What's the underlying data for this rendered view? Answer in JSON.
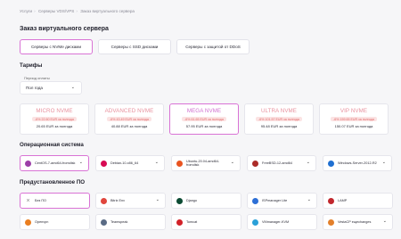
{
  "breadcrumb": [
    "Услуги",
    "Серверы VDS/VPS",
    "Заказ виртуального сервера"
  ],
  "page_title": "Заказ виртуального сервера",
  "server_tabs": [
    {
      "label": "Серверы с NVMe дисками",
      "active": true
    },
    {
      "label": "Серверы с SSD дисками",
      "active": false
    },
    {
      "label": "Серверы с защитой от DDoS",
      "active": false
    }
  ],
  "sections": {
    "tariffs": "Тарифы",
    "os": "Операционная система",
    "software": "Предустановленное ПО"
  },
  "period": {
    "label": "Период оплаты",
    "value": "Пол года",
    "icon": "chevron-down-icon"
  },
  "tariffs": [
    {
      "name": "MICRO NVME",
      "discount": "-6% 22.60 EUR за полгода",
      "price": "20.65 EUR за полгода",
      "active": false
    },
    {
      "name": "ADVANCED NVME",
      "discount": "-6% 43.49 EUR за полгода",
      "price": "40.88 EUR за полгода",
      "active": false
    },
    {
      "name": "MEGA NVME",
      "discount": "-6% 61.65 EUR за полгода",
      "price": "57.95 EUR за полгода",
      "active": true
    },
    {
      "name": "ULTRA NVME",
      "discount": "-6% 101.57 EUR за полгода",
      "price": "95.48 EUR за полгода",
      "active": false
    },
    {
      "name": "VIP NVME",
      "discount": "-6% 159.65 EUR за полгода",
      "price": "150.07 EUR за полгода",
      "active": false
    }
  ],
  "os": [
    {
      "label": "CentOS-7-amd64-fromdisk",
      "icon": "centos-icon",
      "color": "#9c3fa8",
      "dropdown": true,
      "active": true
    },
    {
      "label": "Debian-10-x86_64",
      "icon": "debian-icon",
      "color": "#d70a53",
      "dropdown": true,
      "active": false
    },
    {
      "label": "Ubuntu-20.04-amd64-fromdisk",
      "icon": "ubuntu-icon",
      "color": "#e95420",
      "dropdown": true,
      "active": false
    },
    {
      "label": "FreeBSD-12-amd64",
      "icon": "freebsd-icon",
      "color": "#ab2b28",
      "dropdown": true,
      "active": false
    },
    {
      "label": "Windows-Server-2012-R2",
      "icon": "windows-icon",
      "color": "#1f6fd1",
      "dropdown": true,
      "active": false
    }
  ],
  "software": [
    {
      "label": "Без ПО",
      "icon": "close-icon",
      "color": "#888888",
      "dropdown": false,
      "active": true
    },
    {
      "label": "Bitrix Env",
      "icon": "bitrix-icon",
      "color": "#e0463d",
      "dropdown": true,
      "active": false
    },
    {
      "label": "Django",
      "icon": "django-icon",
      "color": "#0c4b33",
      "dropdown": false,
      "active": false
    },
    {
      "label": "ISPmanager Lite",
      "icon": "ispmanager-icon",
      "color": "#2d6fd6",
      "dropdown": true,
      "active": false
    },
    {
      "label": "LAMP",
      "icon": "lamp-icon",
      "color": "#c1272d",
      "dropdown": false,
      "active": false
    },
    {
      "label": "Openvpn",
      "icon": "openvpn-icon",
      "color": "#ea7e20",
      "dropdown": false,
      "active": false
    },
    {
      "label": "Teamspeak",
      "icon": "teamspeak-icon",
      "color": "#5a6b85",
      "dropdown": false,
      "active": false
    },
    {
      "label": "Tomcat",
      "icon": "tomcat-icon",
      "color": "#d22128",
      "dropdown": false,
      "active": false
    },
    {
      "label": "VMmanager-KVM",
      "icon": "vmmanager-icon",
      "color": "#2aa0d8",
      "dropdown": false,
      "active": false
    },
    {
      "label": "VestaCP ещеchanges",
      "icon": "vestacp-icon",
      "color": "#e3802b",
      "dropdown": true,
      "active": false
    }
  ]
}
